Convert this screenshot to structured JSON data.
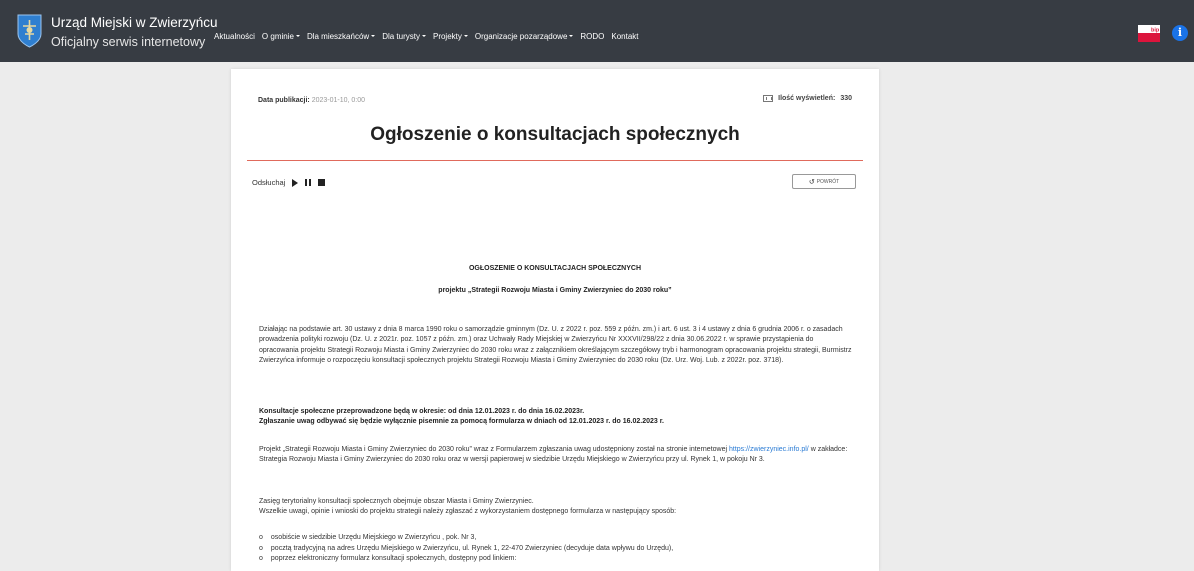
{
  "header": {
    "title": "Urząd Miejski w Zwierzyńcu",
    "subtitle": "Oficjalny serwis internetowy",
    "crest_icon": "town-coat-of-arms",
    "nav": [
      {
        "label": "Aktualności",
        "dropdown": false
      },
      {
        "label": "O gminie",
        "dropdown": true
      },
      {
        "label": "Dla mieszkańców",
        "dropdown": true
      },
      {
        "label": "Dla turysty",
        "dropdown": true
      },
      {
        "label": "Projekty",
        "dropdown": true
      },
      {
        "label": "Organizacje pozarządowe",
        "dropdown": true
      },
      {
        "label": "RODO",
        "dropdown": false
      },
      {
        "label": "Kontakt",
        "dropdown": false
      }
    ],
    "bip_label": "bip",
    "info_label": "i",
    "colors": {
      "bar": "#373c43",
      "info": "#1a73e8",
      "bip_red": "#dc143c"
    }
  },
  "article": {
    "date_label": "Data publikacji:",
    "date_value": "2023-01-10, 0:00",
    "views_label": "Ilość wyświetleń:",
    "views_value": "330",
    "title": "Ogłoszenie o konsultacjach społecznych",
    "listen_label": "Odsłuchaj",
    "back_label": "POWRÓT",
    "heading": "OGŁOSZENIE O KONSULTACJACH SPOŁECZNYCH",
    "subheading": "projektu „Strategii Rozwoju Miasta i Gminy Zwierzyniec do 2030 roku”",
    "p1": "Działając na podstawie art. 30  ustawy z dnia 8 marca 1990 roku o samorządzie gminnym (Dz. U. z 2022 r. poz. 559 z późn. zm.) i art. 6 ust. 3 i 4 ustawy  z dnia 6 grudnia 2006 r. o zasadach prowadzenia polityki rozwoju (Dz. U.  z 2021r. poz. 1057 z późn. zm.)  oraz Uchwały Rady Miejskiej w Zwierzyńcu Nr XXXVII/298/22 z dnia 30.06.2022 r. w sprawie przystąpienia do opracowania projektu Strategii Rozwoju Miasta i Gminy Zwierzyniec do 2030 roku wraz z załącznikiem określającym  szczegółowy tryb i harmonogram opracowania projektu strategii, Burmistrz Zwierzyńca informuje o rozpoczęciu konsultacji społecznych projektu Strategii Rozwoju Miasta i Gminy Zwierzyniec do 2030 roku (Dz. Urz. Woj. Lub. z 2022r. poz. 3718).",
    "p2_line1": "Konsultacje społeczne przeprowadzone będą w okresie: od dnia 12.01.2023 r. do dnia 16.02.2023r.",
    "p2_line2": "Zgłaszanie uwag  odbywać się będzie wyłącznie pisemnie za pomocą formularza w dniach od 12.01.2023 r. do 16.02.2023 r.",
    "p3_before": "Projekt „Strategii Rozwoju Miasta i Gminy Zwierzyniec do 2030 roku”  wraz z Formularzem zgłaszania uwag udostępniony został na stronie internetowej ",
    "p3_link": "https://zwierzyniec.info.pl/",
    "p3_after": " w zakładce: Strategia Rozwoju Miasta i Gminy Zwierzyniec do 2030 roku oraz w wersji papierowej w siedzibie Urzędu Miejskiego w Zwierzyńcu przy ul. Rynek 1, w pokoju Nr 3.",
    "p4_line1": "Zasięg terytorialny konsultacji społecznych obejmuje obszar Miasta i Gminy Zwierzyniec.",
    "p4_line2": "Wszelkie uwagi, opinie i wnioski do projektu strategii należy zgłaszać z wykorzystaniem dostępnego  formularza w następujący sposób:",
    "bullets": [
      "osobiście w siedzibie Urzędu Miejskiego w Zwierzyńcu , pok. Nr 3,",
      "pocztą tradycyjną na adres Urzędu Miejskiego w Zwierzyńcu, ul. Rynek 1, 22-470 Zwierzyniec (decyduje data wpływu do Urzędu),",
      "poprzez elektroniczny formularz konsultacji społecznych, dostępny pod linkiem:"
    ],
    "bullet_marker": "o",
    "colors": {
      "rule": "#e06a5c",
      "link": "#2a7bd4"
    }
  }
}
